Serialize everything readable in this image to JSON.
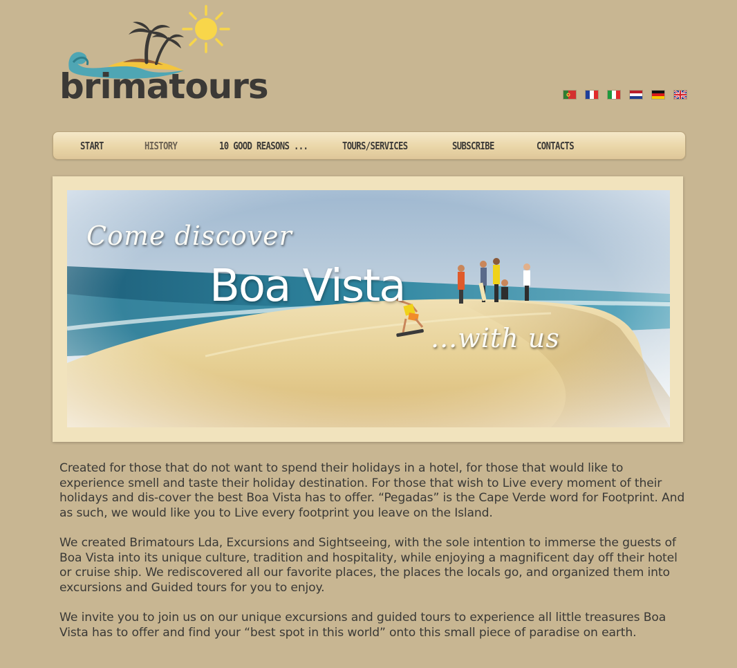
{
  "brand": {
    "logo_text": "brimatours",
    "logo_icon": "palm-tree-sun-wave-logo"
  },
  "languages": [
    {
      "code": "pt",
      "icon": "portugal-flag-icon"
    },
    {
      "code": "fr",
      "icon": "france-flag-icon"
    },
    {
      "code": "it",
      "icon": "italy-flag-icon"
    },
    {
      "code": "nl",
      "icon": "netherlands-flag-icon"
    },
    {
      "code": "de",
      "icon": "germany-flag-icon"
    },
    {
      "code": "en",
      "icon": "uk-flag-icon"
    }
  ],
  "nav": {
    "items": [
      {
        "label": "START"
      },
      {
        "label": "HISTORY"
      },
      {
        "label": "10 GOOD REASONS ..."
      },
      {
        "label": "TOURS/SERVICES"
      },
      {
        "label": "SUBSCRIBE"
      },
      {
        "label": "CONTACTS"
      }
    ],
    "active": "HISTORY"
  },
  "hero": {
    "line1": "Come discover",
    "line2": "Boa Vista",
    "line3": "...with us"
  },
  "content": {
    "paragraphs": [
      "Created for those that do not want to spend their holidays in a hotel, for those that would like to experience smell and taste their holiday destination. For those that wish to Live every moment of their holidays and dis-cover the best Boa Vista has to offer. “Pegadas” is the Cape Verde word for Footprint. And as such, we would like you to Live every footprint you leave on the Island.",
      "We created Brimatours Lda, Excursions and Sightseeing, with the sole intention to immerse the guests of Boa Vista into its unique culture, tradition and hospitality, while enjoying a magnificent day off their hotel or cruise ship. We rediscovered all our favorite places, the places the locals go, and organized them into excursions and Guided tours for you to enjoy.",
      "We invite you to join us on our unique excursions and guided tours to experience all little treasures Boa Vista has to offer and find your “best spot in this world” onto this small piece of paradise on earth."
    ]
  },
  "colors": {
    "page_bg": "#c8b692",
    "text": "#3a3936",
    "nav_text": "#3c3a37",
    "frame": "#f1e3bd",
    "sun": "#f8d64a"
  }
}
